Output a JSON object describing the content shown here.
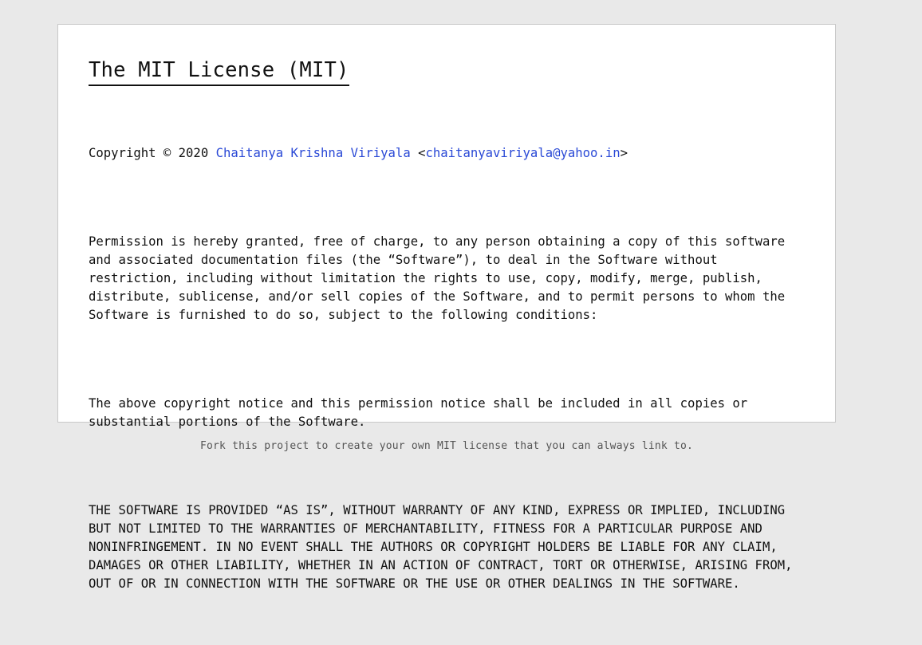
{
  "license": {
    "title": "The MIT License (MIT)",
    "copyright_prefix": "Copyright © 2020 ",
    "author_name": "Chaitanya Krishna Viriyala",
    "email_open": " <",
    "email": "chaitanyaviriyala@yahoo.in",
    "email_close": ">",
    "permission_lines": [
      "Permission is hereby granted, free of charge, to any person obtaining a copy of this software",
      "and associated documentation files (the “Software”), to deal in the Software without",
      "restriction, including without limitation the rights to use, copy, modify, merge, publish,",
      "distribute, sublicense, and/or sell copies of the Software, and to permit persons to whom the",
      "Software is furnished to do so, subject to the following conditions:"
    ],
    "notice_lines": [
      "The above copyright notice and this permission notice shall be included in all copies or",
      "substantial portions of the Software."
    ],
    "warranty_lines": [
      "THE SOFTWARE IS PROVIDED “AS IS”, WITHOUT WARRANTY OF ANY KIND, EXPRESS OR IMPLIED, INCLUDING",
      "BUT NOT LIMITED TO THE WARRANTIES OF MERCHANTABILITY, FITNESS FOR A PARTICULAR PURPOSE AND",
      "NONINFRINGEMENT. IN NO EVENT SHALL THE AUTHORS OR COPYRIGHT HOLDERS BE LIABLE FOR ANY CLAIM,",
      "DAMAGES OR OTHER LIABILITY, WHETHER IN AN ACTION OF CONTRACT, TORT OR OTHERWISE, ARISING FROM,",
      "OUT OF OR IN CONNECTION WITH THE SOFTWARE OR THE USE OR OTHER DEALINGS IN THE SOFTWARE."
    ]
  },
  "footer": {
    "text": "Fork this project to create your own MIT license that you can always link to."
  },
  "colors": {
    "link": "#2a49d6",
    "background": "#e9e9e9",
    "card": "#ffffff"
  }
}
